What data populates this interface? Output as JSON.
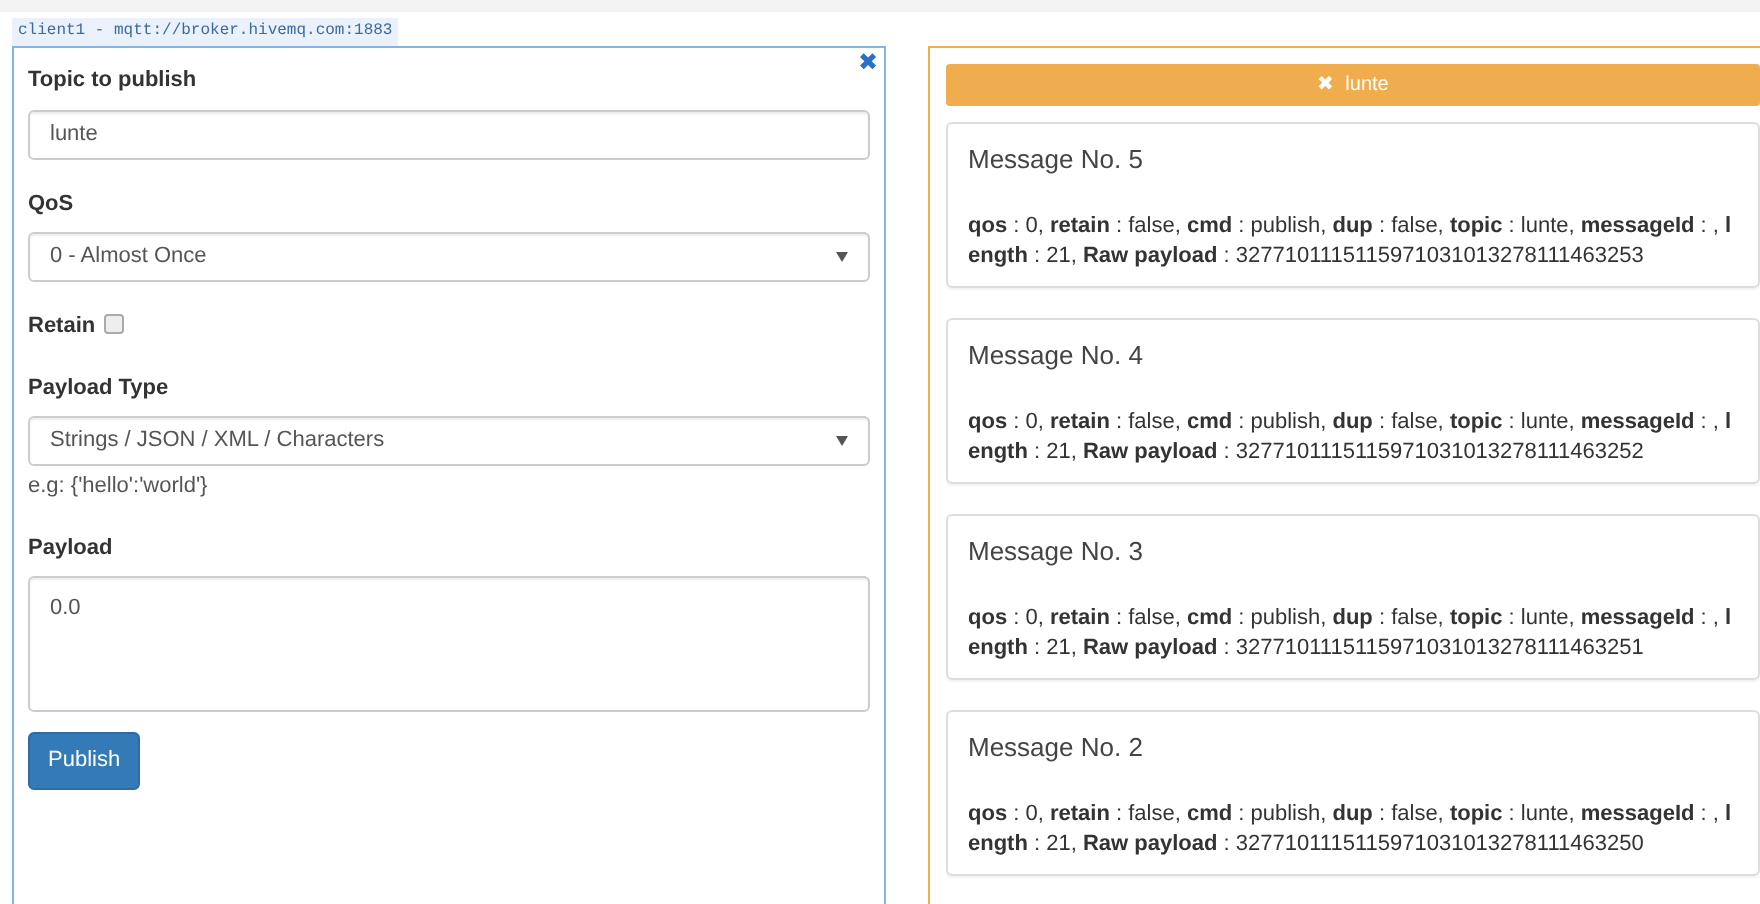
{
  "connection_tab": {
    "label": "client1 - mqtt://broker.hivemq.com:1883"
  },
  "publish_panel": {
    "close_icon": "✖",
    "topic": {
      "label": "Topic to publish",
      "value": "lunte"
    },
    "qos": {
      "label": "QoS",
      "value": "0 - Almost Once"
    },
    "retain": {
      "label": "Retain",
      "checked": false
    },
    "payload_type": {
      "label": "Payload Type",
      "value": "Strings / JSON / XML / Characters",
      "hint": "e.g: {'hello':'world'}"
    },
    "payload": {
      "label": "Payload",
      "value": "0.0"
    },
    "publish_button": "Publish"
  },
  "subscription_panel": {
    "topic_bar": {
      "icon": "✖",
      "label": "lunte"
    },
    "messages": [
      {
        "title": "Message No. 5",
        "body": "**qos** : 0, **retain** : false, **cmd** : publish, **dup** : false, **topic** : lunte, **messageId** : , **length** : 21, **Raw payload** : 3277101115115971031013278111463253"
      },
      {
        "title": "Message No. 4",
        "body": "**qos** : 0, **retain** : false, **cmd** : publish, **dup** : false, **topic** : lunte, **messageId** : , **length** : 21, **Raw payload** : 3277101115115971031013278111463252"
      },
      {
        "title": "Message No. 3",
        "body": "**qos** : 0, **retain** : false, **cmd** : publish, **dup** : false, **topic** : lunte, **messageId** : , **length** : 21, **Raw payload** : 3277101115115971031013278111463251"
      },
      {
        "title": "Message No. 2",
        "body": "**qos** : 0, **retain** : false, **cmd** : publish, **dup** : false, **topic** : lunte, **messageId** : , **length** : 21, **Raw payload** : 3277101115115971031013278111463250"
      }
    ]
  }
}
